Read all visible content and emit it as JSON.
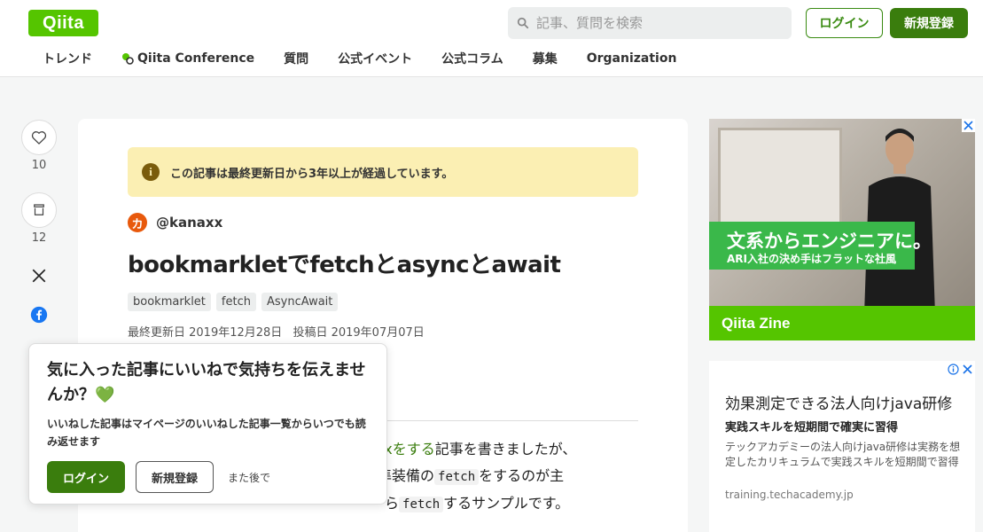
{
  "header": {
    "logo": "Qiita",
    "search_placeholder": "記事、質問を検索",
    "login_label": "ログイン",
    "signup_label": "新規登録"
  },
  "nav": {
    "items": [
      "トレンド",
      "Qiita Conference",
      "質問",
      "公式イベント",
      "公式コラム",
      "募集",
      "Organization"
    ]
  },
  "side": {
    "like_count": "10",
    "stock_count": "12"
  },
  "article": {
    "notice": "この記事は最終更新日から3年以上が経過しています。",
    "author": "@kanaxx",
    "title": "bookmarkletでfetchとasyncとawait",
    "tags": [
      "bookmarklet",
      "fetch",
      "AsyncAwait"
    ],
    "updated": "最終更新日 2019年12月28日",
    "posted": "投稿日 2019年07月07日",
    "body_link": "ってajaxをする",
    "body_1": "記事を書きましたが、",
    "body_2": "なく標準装備の",
    "body_code1": "fetch",
    "body_3": "をするのが主",
    "body_4": "ら",
    "body_code2": "fetch",
    "body_5": "するサンプルです。"
  },
  "popup": {
    "title": "気に入った記事にいいねで気持ちを伝えませんか？💚",
    "desc": "いいねした記事はマイページのいいねした記事一覧からいつでも読み返せます",
    "login_label": "ログイン",
    "signup_label": "新規登録",
    "later_label": "また後で"
  },
  "ad1": {
    "headline": "文系からエンジニアに。",
    "subline": "ARI入社の決め手はフラットな社風",
    "footer": "Qiita Zine"
  },
  "ad2": {
    "title": "効果測定できる法人向けjava研修",
    "subtitle": "実践スキルを短期間で確実に習得",
    "desc": "テックアカデミーの法人向けjava研修は実務を想定したカリキュラムで実践スキルを短期間で習得",
    "url": "training.techacademy.jp"
  },
  "colors": {
    "brand": "#55c500",
    "primary_button": "#3a7d0d",
    "notice_bg": "#fbefb3"
  }
}
